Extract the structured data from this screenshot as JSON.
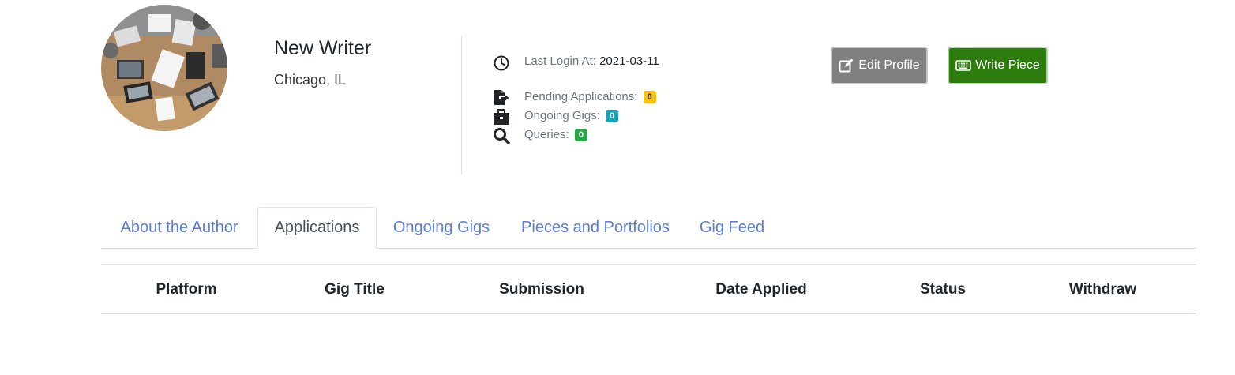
{
  "profile": {
    "name": "New Writer",
    "location": "Chicago, IL"
  },
  "info": {
    "last_login_label": "Last Login At:",
    "last_login_value": "2021-03-11",
    "pending_label": "Pending Applications:",
    "pending_count": "0",
    "ongoing_label": "Ongoing Gigs:",
    "ongoing_count": "0",
    "queries_label": "Queries:",
    "queries_count": "0",
    "icons": [
      "clock-icon",
      "file-export-icon",
      "briefcase-icon",
      "search-icon"
    ]
  },
  "actions": {
    "edit_label": "Edit Profile",
    "write_label": "Write Piece",
    "edit_icon": "edit-icon",
    "write_icon": "keyboard-icon"
  },
  "tabs": [
    {
      "label": "About the Author",
      "active": false
    },
    {
      "label": "Applications",
      "active": true
    },
    {
      "label": "Ongoing Gigs",
      "active": false
    },
    {
      "label": "Pieces and Portfolios",
      "active": false
    },
    {
      "label": "Gig Feed",
      "active": false
    }
  ],
  "table": {
    "columns": [
      "Platform",
      "Gig Title",
      "Submission",
      "Date Applied",
      "Status",
      "Withdraw"
    ],
    "rows": []
  },
  "colors": {
    "link": "#5b7cd6",
    "badge_warning": "#ffc107",
    "badge_info": "#17a2b8",
    "badge_success": "#28a745",
    "edit_button": "#808080",
    "write_button": "#2d7d0e"
  }
}
